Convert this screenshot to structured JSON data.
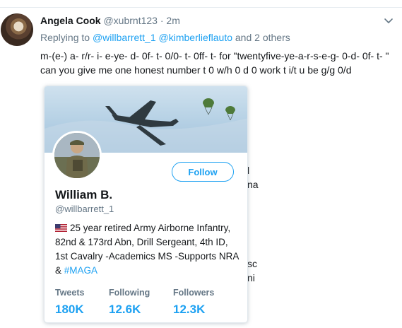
{
  "tweet": {
    "author_name": "Angela Cook",
    "author_handle": "@xubrnt123",
    "separator": "·",
    "timestamp": "2m",
    "menu_icon": "chevron-down-icon",
    "reply_prefix": "Replying to",
    "mention_1": "@willbarrett_1",
    "mention_2": "@kimberlieflauto",
    "reply_suffix": "and 2 others",
    "text": "m-(e-) a- r/r- i- e-ye- d- 0f- t- 0/0- t- 0ff- t- for \"twentyfive-ye-a-r-s-e-g- 0-d- 0f- t- \" can you give me one honest number t 0 w/h 0 d 0 work t i/t u be g/g 0/d"
  },
  "background_fragments": [
    "l",
    "na",
    "sc",
    "ni"
  ],
  "profile_card": {
    "name": "William B.",
    "handle": "@willbarrett_1",
    "follow_label": "Follow",
    "bio_flag": "us-flag-icon",
    "bio_text": "25 year retired Army Airborne Infantry, 82nd & 173rd Abn, Drill Sergeant, 4th ID, 1st Cavalry -Academics MS -Supports NRA &",
    "bio_hashtag": "#MAGA",
    "stats": [
      {
        "label": "Tweets",
        "value": "180K"
      },
      {
        "label": "Following",
        "value": "12.6K"
      },
      {
        "label": "Followers",
        "value": "12.3K"
      }
    ]
  },
  "colors": {
    "accent": "#1da1f2",
    "secondary_text": "#657786",
    "primary_text": "#14171a",
    "border": "#e1e8ed"
  }
}
